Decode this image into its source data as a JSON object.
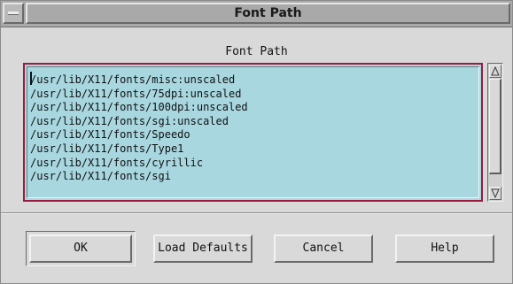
{
  "window": {
    "title": "Font Path"
  },
  "list": {
    "caption": "Font Path",
    "items": [
      "/usr/lib/X11/fonts/misc:unscaled",
      "/usr/lib/X11/fonts/75dpi:unscaled",
      "/usr/lib/X11/fonts/100dpi:unscaled",
      "/usr/lib/X11/fonts/sgi:unscaled",
      "/usr/lib/X11/fonts/Speedo",
      "/usr/lib/X11/fonts/Type1",
      "/usr/lib/X11/fonts/cyrillic",
      "/usr/lib/X11/fonts/sgi"
    ]
  },
  "buttons": {
    "ok": "OK",
    "load_defaults": "Load Defaults",
    "cancel": "Cancel",
    "help": "Help"
  },
  "icons": {
    "window_menu": "window-menu-icon",
    "scroll_up": "arrow-up-icon",
    "scroll_down": "arrow-down-icon"
  },
  "colors": {
    "list_background": "#a8d7e0",
    "focus_border": "#9b1b3c",
    "window_background": "#d9d9d9"
  }
}
